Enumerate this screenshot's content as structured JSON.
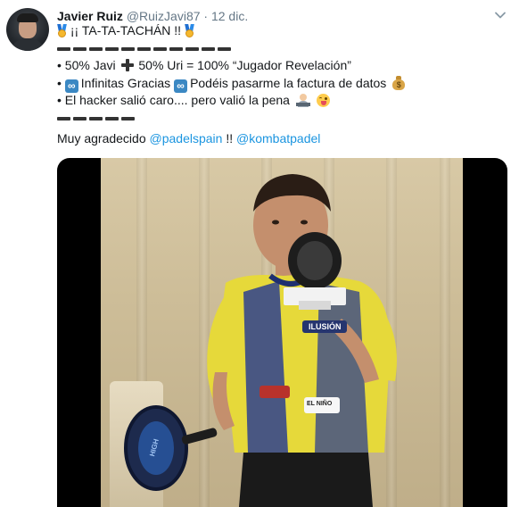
{
  "tweet": {
    "author_name": "Javier Ruiz",
    "author_handle": "@RuizJavi87",
    "separator": "·",
    "date": "12 dic.",
    "lines": {
      "title_text": "¡¡ TA-TA-TACHÁN !!",
      "bullet1_a": "• 50% Javi",
      "bullet1_b": "50% Uri = 100% “Jugador Revelación”",
      "bullet2_a": "•",
      "bullet2_b": "Infinitas Gracias",
      "bullet2_c": "Podéis pasarme la factura de datos",
      "bullet3": "• El hacker salió caro.... pero valió la pena",
      "thanks_text": "Muy agradecido",
      "mention1": "@padelspain",
      "thanks_sep": "!!",
      "mention2": "@kombatpadel"
    },
    "infinity_glyph": "∞",
    "money_glyph": "$",
    "video": {
      "shirt_text": "ILUSIÓN",
      "sponsor_text": "EL NIÑO",
      "racket_text": "HIGH"
    }
  },
  "colors": {
    "link": "#1b95e0",
    "muted": "#657786",
    "text": "#14171a"
  }
}
